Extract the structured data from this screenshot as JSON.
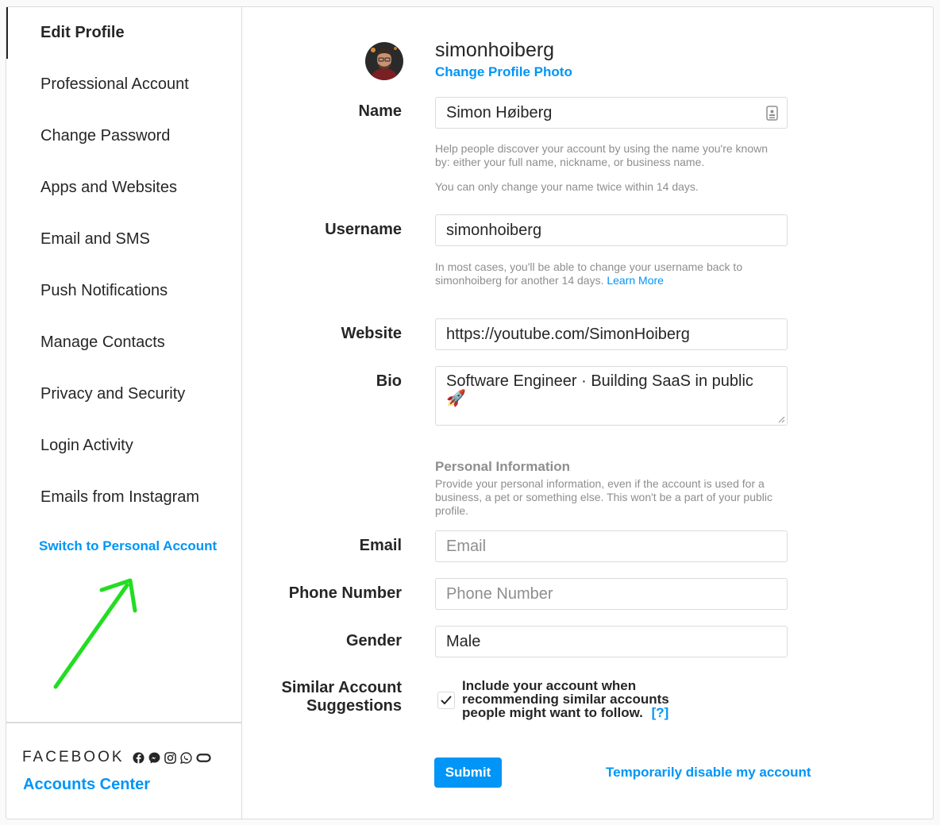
{
  "sidebar": {
    "items": [
      {
        "label": "Edit Profile"
      },
      {
        "label": "Professional Account"
      },
      {
        "label": "Change Password"
      },
      {
        "label": "Apps and Websites"
      },
      {
        "label": "Email and SMS"
      },
      {
        "label": "Push Notifications"
      },
      {
        "label": "Manage Contacts"
      },
      {
        "label": "Privacy and Security"
      },
      {
        "label": "Login Activity"
      },
      {
        "label": "Emails from Instagram"
      }
    ],
    "switch_link": "Switch to Personal Account",
    "footer": {
      "brand": "FACEBOOK",
      "accounts_center": "Accounts Center",
      "icons": [
        "facebook-icon",
        "messenger-icon",
        "instagram-icon",
        "whatsapp-icon",
        "oculus-icon"
      ]
    }
  },
  "profile": {
    "username": "simonhoiberg",
    "change_photo": "Change Profile Photo"
  },
  "form": {
    "name": {
      "label": "Name",
      "value": "Simon Høiberg",
      "help1": "Help people discover your account by using the name you're known by: either your full name, nickname, or business name.",
      "help2": "You can only change your name twice within 14 days."
    },
    "username": {
      "label": "Username",
      "value": "simonhoiberg",
      "help": "In most cases, you'll be able to change your username back to simonhoiberg for another 14 days.",
      "learn_more": "Learn More"
    },
    "website": {
      "label": "Website",
      "value": "https://youtube.com/SimonHoiberg"
    },
    "bio": {
      "label": "Bio",
      "value": "Software Engineer · Building SaaS in public 🚀"
    },
    "personal_info": {
      "title": "Personal Information",
      "help": "Provide your personal information, even if the account is used for a business, a pet or something else. This won't be a part of your public profile."
    },
    "email": {
      "label": "Email",
      "placeholder": "Email"
    },
    "phone": {
      "label": "Phone Number",
      "placeholder": "Phone Number"
    },
    "gender": {
      "label": "Gender",
      "value": "Male"
    },
    "suggestions": {
      "label_line1": "Similar Account",
      "label_line2": "Suggestions",
      "checked": true,
      "text": "Include your account when recommending similar accounts people might want to follow.",
      "help_link": "[?]"
    },
    "submit": "Submit",
    "disable": "Temporarily disable my account"
  },
  "colors": {
    "accent": "#0095f6",
    "annotation_arrow": "#22dd22"
  }
}
